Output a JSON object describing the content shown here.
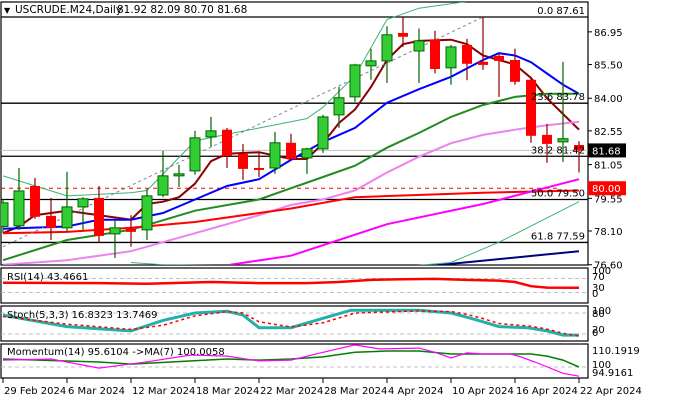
{
  "header": {
    "arrow": "▼",
    "symbol": "USCRUDE.M24,Daily",
    "ohlc": "81.92 82.09 80.70 81.68"
  },
  "price_axis": {
    "ticks": [
      "86.95",
      "85.50",
      "84.00",
      "82.55",
      "81.05",
      "79.55",
      "78.10",
      "76.60"
    ],
    "tick_values": [
      86.95,
      85.5,
      84.0,
      82.55,
      81.05,
      79.55,
      78.1,
      76.6
    ],
    "current_price": "81.68",
    "current_value": 81.68,
    "alert_price": "80.00",
    "alert_value": 80.0
  },
  "fib_levels": [
    {
      "label": "0.0 87.61",
      "value": 87.61
    },
    {
      "label": "23.6 83.78",
      "value": 83.78
    },
    {
      "label": "38.2 81.42",
      "value": 81.42
    },
    {
      "label": "50.0 79.50",
      "value": 79.5
    },
    {
      "label": "61.8 77.59",
      "value": 77.59
    }
  ],
  "dates": [
    "29 Feb 2024",
    "6 Mar 2024",
    "12 Mar 2024",
    "18 Mar 2024",
    "22 Mar 2024",
    "28 Mar 2024",
    "4 Apr 2024",
    "10 Apr 2024",
    "16 Apr 2024",
    "22 Apr 2024"
  ],
  "colors": {
    "bull": "#32cd32",
    "bear": "#ff0000",
    "bull_border": "#006400",
    "bear_border": "#8b0000",
    "alert": "#ff0000"
  },
  "chart_data": {
    "type": "candlestick",
    "title": "USCRUDE.M24,Daily",
    "ylim": [
      76.4,
      87.8
    ],
    "candles": [
      [
        78.3,
        79.5,
        78.0,
        79.35
      ],
      [
        78.33,
        80.9,
        78.15,
        79.88
      ],
      [
        80.1,
        80.46,
        78.64,
        78.73
      ],
      [
        78.77,
        79.57,
        77.7,
        78.24
      ],
      [
        78.24,
        80.73,
        78.06,
        79.17
      ],
      [
        79.17,
        79.6,
        78.15,
        79.53
      ],
      [
        79.57,
        80.1,
        77.6,
        77.88
      ],
      [
        77.97,
        78.6,
        76.9,
        78.24
      ],
      [
        78.2,
        78.8,
        77.4,
        78.06
      ],
      [
        78.15,
        79.97,
        77.7,
        79.66
      ],
      [
        79.7,
        81.66,
        79.6,
        80.55
      ],
      [
        80.55,
        81.04,
        80.06,
        80.64
      ],
      [
        80.77,
        82.55,
        80.6,
        82.24
      ],
      [
        82.28,
        83.17,
        81.84,
        82.55
      ],
      [
        82.6,
        82.68,
        80.9,
        81.44
      ],
      [
        81.53,
        81.97,
        80.37,
        80.86
      ],
      [
        80.9,
        81.6,
        80.5,
        80.82
      ],
      [
        80.9,
        82.5,
        80.64,
        82.02
      ],
      [
        82.02,
        82.42,
        81.26,
        81.3
      ],
      [
        81.35,
        81.8,
        80.64,
        81.75
      ],
      [
        81.75,
        83.26,
        81.57,
        83.17
      ],
      [
        83.26,
        84.5,
        82.68,
        84.02
      ],
      [
        84.06,
        85.53,
        83.84,
        85.48
      ],
      [
        85.44,
        86.2,
        84.82,
        85.66
      ],
      [
        85.66,
        87.2,
        84.68,
        86.82
      ],
      [
        86.9,
        87.6,
        86.28,
        86.73
      ],
      [
        86.1,
        87.1,
        84.68,
        86.55
      ],
      [
        86.6,
        87.0,
        85.1,
        85.3
      ],
      [
        85.35,
        86.37,
        84.6,
        86.28
      ],
      [
        86.37,
        86.64,
        84.8,
        85.53
      ],
      [
        85.62,
        87.61,
        85.26,
        85.48
      ],
      [
        85.88,
        86.0,
        84.06,
        85.66
      ],
      [
        85.7,
        86.2,
        84.6,
        84.73
      ],
      [
        84.82,
        84.95,
        82.02,
        82.33
      ],
      [
        82.37,
        82.86,
        81.13,
        81.97
      ],
      [
        82.06,
        85.62,
        81.17,
        82.2
      ],
      [
        81.92,
        82.09,
        80.7,
        81.68
      ]
    ],
    "overlays": [
      {
        "name": "ma-maroon",
        "color": "#8b0000",
        "width": 2,
        "points": [
          [
            0,
            78.0
          ],
          [
            1,
            78.3
          ],
          [
            2,
            78.8
          ],
          [
            4,
            79.0
          ],
          [
            6,
            78.8
          ],
          [
            8,
            78.6
          ],
          [
            9,
            79.3
          ],
          [
            10,
            79.4
          ],
          [
            11,
            79.6
          ],
          [
            12,
            80.2
          ],
          [
            13,
            81.2
          ],
          [
            14,
            81.53
          ],
          [
            16,
            81.6
          ],
          [
            18,
            81.3
          ],
          [
            19,
            81.3
          ],
          [
            20,
            82.0
          ],
          [
            21,
            82.9
          ],
          [
            22,
            83.5
          ],
          [
            23,
            84.5
          ],
          [
            24,
            85.7
          ],
          [
            25,
            86.4
          ],
          [
            26,
            86.55
          ],
          [
            28,
            86.6
          ],
          [
            29,
            86.4
          ],
          [
            30,
            85.9
          ],
          [
            31,
            85.7
          ],
          [
            32,
            85.5
          ],
          [
            33,
            84.9
          ],
          [
            34,
            84.0
          ],
          [
            35,
            83.3
          ],
          [
            36,
            82.6
          ]
        ]
      },
      {
        "name": "ma-blue",
        "color": "#0000ff",
        "width": 2,
        "points": [
          [
            0,
            78.2
          ],
          [
            4,
            78.3
          ],
          [
            6,
            78.6
          ],
          [
            8,
            78.6
          ],
          [
            10,
            78.9
          ],
          [
            12,
            79.5
          ],
          [
            14,
            80.1
          ],
          [
            16,
            80.4
          ],
          [
            18,
            81.26
          ],
          [
            20,
            82.06
          ],
          [
            22,
            82.68
          ],
          [
            24,
            83.8
          ],
          [
            26,
            84.4
          ],
          [
            28,
            84.95
          ],
          [
            30,
            85.7
          ],
          [
            31,
            86.0
          ],
          [
            32,
            85.9
          ],
          [
            33,
            85.6
          ],
          [
            34,
            85.1
          ],
          [
            35,
            84.6
          ],
          [
            36,
            84.2
          ]
        ]
      },
      {
        "name": "ma-green",
        "color": "#228b22",
        "width": 2,
        "points": [
          [
            0,
            76.8
          ],
          [
            4,
            77.7
          ],
          [
            8,
            78.15
          ],
          [
            12,
            79.0
          ],
          [
            16,
            79.5
          ],
          [
            18,
            80.0
          ],
          [
            20,
            80.5
          ],
          [
            22,
            81.0
          ],
          [
            24,
            81.8
          ],
          [
            26,
            82.46
          ],
          [
            28,
            83.17
          ],
          [
            30,
            83.7
          ],
          [
            32,
            84.06
          ],
          [
            34,
            84.2
          ],
          [
            36,
            84.2
          ]
        ]
      },
      {
        "name": "ma-violet",
        "color": "#ee82ee",
        "width": 2,
        "points": [
          [
            0,
            76.6
          ],
          [
            4,
            76.8
          ],
          [
            8,
            77.2
          ],
          [
            12,
            78.0
          ],
          [
            16,
            78.8
          ],
          [
            18,
            79.26
          ],
          [
            20,
            79.5
          ],
          [
            22,
            79.9
          ],
          [
            24,
            80.7
          ],
          [
            26,
            81.4
          ],
          [
            28,
            82.0
          ],
          [
            30,
            82.37
          ],
          [
            32,
            82.6
          ],
          [
            34,
            82.8
          ],
          [
            36,
            82.95
          ]
        ]
      },
      {
        "name": "ma-red",
        "color": "#ff0000",
        "width": 2,
        "points": [
          [
            0,
            78.0
          ],
          [
            4,
            78.06
          ],
          [
            8,
            78.24
          ],
          [
            12,
            78.5
          ],
          [
            16,
            78.9
          ],
          [
            18,
            79.1
          ],
          [
            22,
            79.6
          ],
          [
            30,
            79.8
          ],
          [
            36,
            79.9
          ]
        ]
      },
      {
        "name": "ma-magenta",
        "color": "#ff00ff",
        "width": 2,
        "points": [
          [
            14.2,
            76.6
          ],
          [
            18,
            77.0
          ],
          [
            24,
            78.4
          ],
          [
            30,
            79.3
          ],
          [
            36,
            80.4
          ]
        ]
      },
      {
        "name": "ma-navy",
        "color": "#000080",
        "width": 2,
        "points": [
          [
            0,
            76.55
          ],
          [
            26.7,
            76.55
          ],
          [
            36,
            77.2
          ]
        ]
      },
      {
        "name": "envelope-upper",
        "color": "#3cb371",
        "width": 1,
        "points": [
          [
            0,
            80.55
          ],
          [
            4,
            79.66
          ],
          [
            8,
            79.8
          ],
          [
            9,
            79.9
          ],
          [
            12,
            82.1
          ],
          [
            14,
            82.4
          ],
          [
            18,
            82.95
          ],
          [
            19,
            83.1
          ],
          [
            20,
            83.6
          ],
          [
            22,
            85.0
          ],
          [
            24,
            87.5
          ],
          [
            26,
            88.0
          ],
          [
            30,
            88.4
          ],
          [
            32,
            88.5
          ],
          [
            36,
            88.3
          ]
        ]
      },
      {
        "name": "envelope-lower",
        "color": "#3cb371",
        "width": 1,
        "points": [
          [
            8,
            76.7
          ],
          [
            10,
            76.6
          ],
          [
            24,
            76.45
          ],
          [
            28,
            76.7
          ],
          [
            31,
            77.6
          ],
          [
            36,
            79.4
          ]
        ]
      },
      {
        "name": "trend-line",
        "color": "#778899",
        "width": 1,
        "dash": "3,3",
        "points": [
          [
            0,
            77.4
          ],
          [
            30,
            87.61
          ]
        ]
      }
    ],
    "rsi": {
      "label": "RSI(14) 43.4661",
      "levels": [
        70,
        30
      ],
      "axis": [
        "100",
        "70",
        "30",
        "0"
      ],
      "color": "#ff0000",
      "points": [
        [
          0,
          58
        ],
        [
          6,
          57
        ],
        [
          9,
          55
        ],
        [
          13,
          60
        ],
        [
          16,
          57
        ],
        [
          19,
          57
        ],
        [
          21,
          60
        ],
        [
          23,
          66
        ],
        [
          25,
          68
        ],
        [
          27,
          69
        ],
        [
          29,
          66
        ],
        [
          31,
          64
        ],
        [
          32,
          60
        ],
        [
          33,
          48
        ],
        [
          34,
          44
        ],
        [
          36,
          43.5
        ]
      ]
    },
    "stoch": {
      "label": "Stoch(5,3,3) 16.8323 13.7469",
      "levels": [
        80,
        20
      ],
      "axis": [
        "100",
        "80",
        "20",
        "0"
      ],
      "main_color": "#20b2aa",
      "signal_color": "#ff0000",
      "main": [
        [
          0,
          74
        ],
        [
          4,
          41
        ],
        [
          8,
          29
        ],
        [
          10,
          59
        ],
        [
          12,
          80
        ],
        [
          14,
          85
        ],
        [
          15,
          74
        ],
        [
          16,
          38
        ],
        [
          18,
          38
        ],
        [
          20,
          65
        ],
        [
          21.75,
          88
        ],
        [
          26,
          88
        ],
        [
          28,
          80
        ],
        [
          29,
          68
        ],
        [
          30,
          55
        ],
        [
          31,
          41
        ],
        [
          32.75,
          38
        ],
        [
          34,
          29
        ],
        [
          35,
          17
        ],
        [
          36,
          16.8
        ]
      ],
      "signal": [
        [
          0,
          70
        ],
        [
          4,
          48
        ],
        [
          8,
          33
        ],
        [
          10,
          45
        ],
        [
          12,
          72
        ],
        [
          14,
          84
        ],
        [
          15,
          80
        ],
        [
          16,
          55
        ],
        [
          18,
          40
        ],
        [
          20,
          52
        ],
        [
          22,
          80
        ],
        [
          26,
          86
        ],
        [
          28,
          84
        ],
        [
          29,
          76
        ],
        [
          30,
          64
        ],
        [
          31,
          50
        ],
        [
          33,
          42
        ],
        [
          34,
          34
        ],
        [
          35,
          22
        ],
        [
          36,
          13.7
        ]
      ]
    },
    "momentum": {
      "label": "Momentum(14) 95.6104  ->MA(7) 100.0058",
      "level": 100,
      "axis": [
        "110.1919",
        "100",
        "94.9161"
      ],
      "range": [
        94.9161,
        110.1919
      ],
      "mom_color": "#ff00ff",
      "ma_color": "#008000",
      "mom": [
        [
          0,
          103.3
        ],
        [
          3,
          103.8
        ],
        [
          6,
          99.5
        ],
        [
          9,
          102.5
        ],
        [
          11.75,
          105.7
        ],
        [
          14,
          105.2
        ],
        [
          16,
          102.9
        ],
        [
          18,
          103.3
        ],
        [
          20,
          107
        ],
        [
          22,
          110.5
        ],
        [
          23.5,
          108.6
        ],
        [
          26,
          109
        ],
        [
          27,
          107
        ],
        [
          28,
          104.3
        ],
        [
          29,
          106.7
        ],
        [
          30,
          106.2
        ],
        [
          31.7,
          106.2
        ],
        [
          32.3,
          105
        ],
        [
          33.25,
          102.4
        ],
        [
          35,
          97
        ],
        [
          36,
          95.6
        ]
      ],
      "ma": [
        [
          0,
          103.8
        ],
        [
          6,
          102.4
        ],
        [
          8,
          101.4
        ],
        [
          14,
          103.8
        ],
        [
          16,
          103.3
        ],
        [
          18,
          103.8
        ],
        [
          20,
          104.8
        ],
        [
          22,
          107
        ],
        [
          24,
          107.6
        ],
        [
          26,
          107.6
        ],
        [
          28,
          106.2
        ],
        [
          33,
          106.2
        ],
        [
          34,
          105.2
        ],
        [
          35,
          103.3
        ],
        [
          36,
          100
        ]
      ]
    }
  }
}
